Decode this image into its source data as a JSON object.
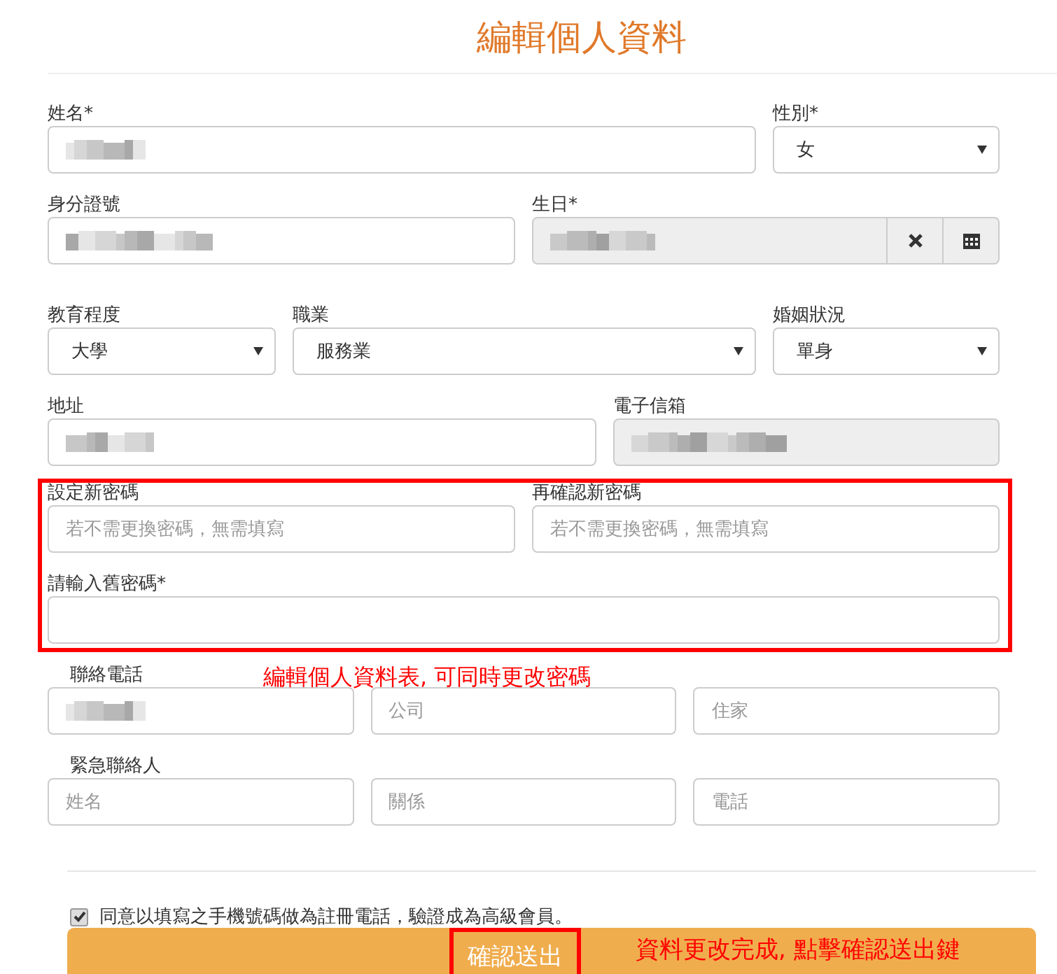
{
  "title": "編輯個人資料",
  "sections": [
    {
      "highlighted": false,
      "rows": [
        {
          "fields": [
            {
              "label": "姓名*",
              "kind": "text",
              "redacted": true,
              "disabled": false
            },
            {
              "label": "性別*",
              "kind": "select",
              "value": "女"
            }
          ]
        },
        {
          "fields": [
            {
              "label": "身分證號",
              "kind": "text",
              "redacted": true,
              "disabled": false
            },
            {
              "label": "生日*",
              "kind": "date",
              "redacted": true,
              "disabled": true
            }
          ]
        },
        {
          "fields": [
            {
              "label": "教育程度",
              "kind": "select",
              "value": "大學"
            },
            {
              "label": "職業",
              "kind": "select",
              "value": "服務業"
            },
            {
              "label": "婚姻狀況",
              "kind": "select",
              "value": "單身"
            }
          ]
        },
        {
          "fields": [
            {
              "label": "地址",
              "kind": "text",
              "redacted": true,
              "disabled": false
            },
            {
              "label": "電子信箱",
              "kind": "text",
              "redacted": true,
              "disabled": true
            }
          ]
        }
      ]
    },
    {
      "highlighted": true,
      "rows": [
        {
          "fields": [
            {
              "label": "設定新密碼",
              "kind": "text",
              "placeholder": "若不需更換密碼，無需填寫",
              "disabled": false
            },
            {
              "label": "再確認新密碼",
              "kind": "text",
              "placeholder": "若不需更換密碼，無需填寫",
              "disabled": false
            }
          ]
        },
        {
          "fields": [
            {
              "label": "請輸入舊密碼*",
              "kind": "text",
              "disabled": false
            }
          ]
        }
      ]
    },
    {
      "highlighted": false,
      "rows": [
        {
          "label": "聯絡電話",
          "note": "編輯個人資料表, 可同時更改密碼",
          "fields": [
            {
              "kind": "text",
              "redacted": true,
              "disabled": false
            },
            {
              "kind": "text",
              "placeholder": "公司",
              "disabled": false
            },
            {
              "kind": "text",
              "placeholder": "住家",
              "disabled": false
            }
          ]
        },
        {
          "label": "緊急聯絡人",
          "fields": [
            {
              "kind": "text",
              "placeholder": "姓名",
              "disabled": false
            },
            {
              "kind": "text",
              "placeholder": "關係",
              "disabled": false
            },
            {
              "kind": "text",
              "placeholder": "電話",
              "disabled": false
            }
          ]
        }
      ]
    }
  ],
  "agreement": {
    "text": "同意以填寫之手機號碼做為註冊電話，驗證成為高級會員。",
    "checked": true
  },
  "submit": {
    "label": "確認送出",
    "highlighted": true,
    "note": "資料更改完成, 點擊確認送出鍵"
  }
}
